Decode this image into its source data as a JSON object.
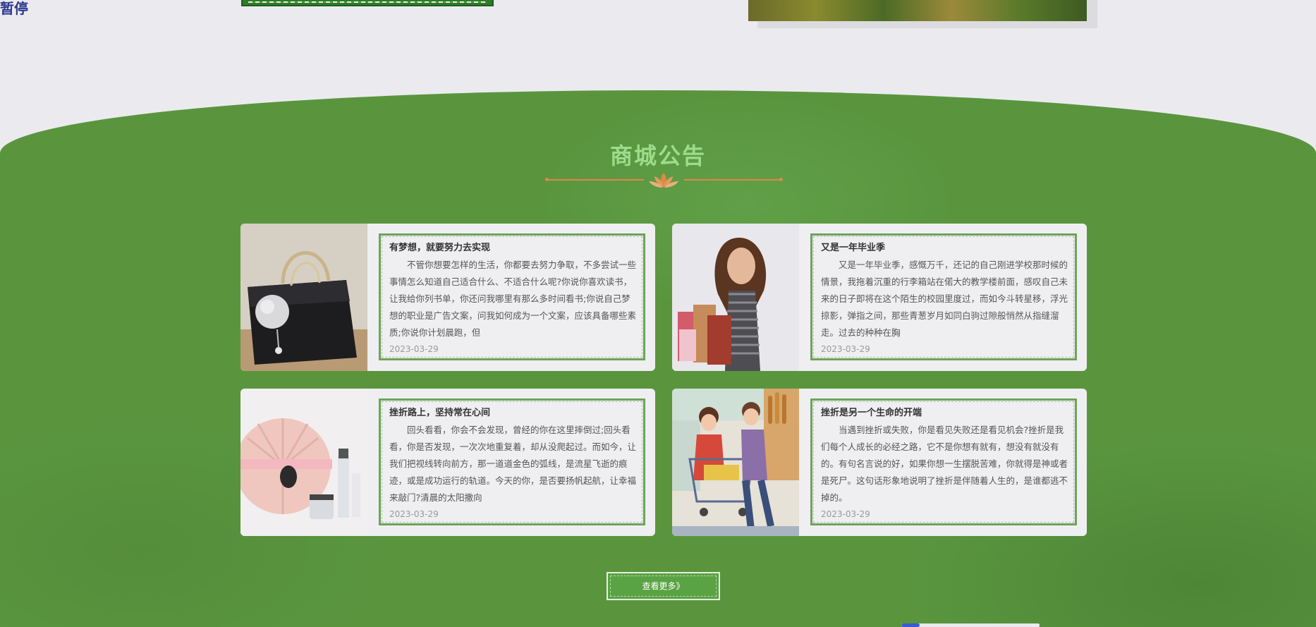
{
  "overlay": {
    "pause_label": "暂停"
  },
  "section": {
    "title": "商城公告"
  },
  "cards": [
    {
      "title": "有梦想，就要努力去实现",
      "text": "不管你想要怎样的生活，你都要去努力争取，不多尝试一些事情怎么知道自己适合什么、不适合什么呢?你说你喜欢读书，让我给你列书单，你还问我哪里有那么多时间看书;你说自己梦想的职业是广告文案，问我如何成为一个文案，应该具备哪些素质;你说你计划晨跑，但",
      "date": "2023-03-29",
      "image": "handbag-photo"
    },
    {
      "title": "又是一年毕业季",
      "text": "又是一年毕业季，感慨万千，还记的自己刚进学校那时候的情景，我拖着沉重的行李箱站在偌大的教学楼前面，感叹自己未来的日子即将在这个陌生的校园里度过，而如今斗转星移，浮光掠影，弹指之间，那些青葱岁月如同白驹过隙般悄然从指缝溜走。过去的种种在胸",
      "date": "2023-03-29",
      "image": "shopping-woman-photo"
    },
    {
      "title": "挫折路上，坚持常在心间",
      "text": "回头看看，你会不会发现，曾经的你在这里摔倒过;回头看看，你是否发现，一次次地重复着，却从没爬起过。而如今，让我们把视线转向前方，那一道道金色的弧线，是流星飞逝的痕迹，或是成功运行的轨道。今天的你，是否要扬帆起航，让幸福来敲门?清晨的太阳撒向",
      "date": "2023-03-29",
      "image": "cosmetics-photo"
    },
    {
      "title": "挫折是另一个生命的开端",
      "text": "当遇到挫折或失败，你是看见失败还是看见机会?挫折是我们每个人成长的必经之路，它不是你想有就有，想没有就没有的。有句名言说的好，如果你想一生摆脱苦难，你就得是神或者是死尸。这句话形象地说明了挫折是伴随着人生的，是谁都逃不掉的。",
      "date": "2023-03-29",
      "image": "supermarket-cartoon"
    }
  ],
  "more_button": {
    "label": "查看更多》"
  },
  "colors": {
    "green_bg": "#5a953e",
    "title_green": "#9edb8c",
    "accent_orange": "#e0874a",
    "card_border": "#6da35a"
  }
}
